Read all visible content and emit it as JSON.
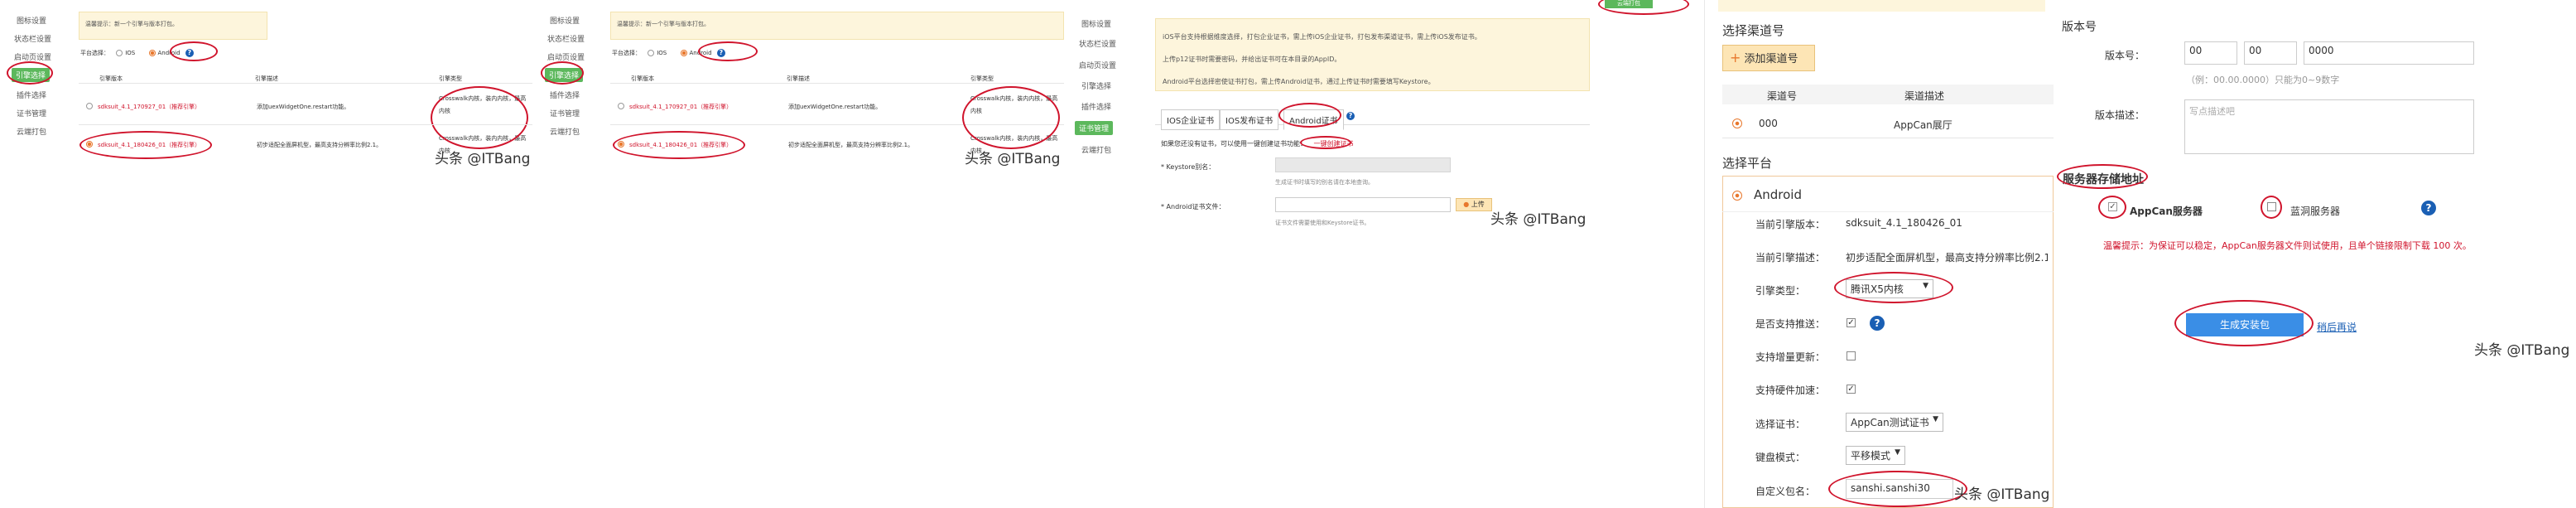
{
  "watermark": "头条 @ITBang",
  "panel1": {
    "sidebar": [
      "图标设置",
      "状态栏设置",
      "启动页设置",
      "引擎选择",
      "插件选择",
      "证书管理",
      "云端打包"
    ],
    "active_index": 3,
    "notice": "温馨提示：新一个引擎与版本打包。",
    "platform_label": "平台选择：",
    "platform_options": [
      "IOS",
      "Android"
    ],
    "table_headers": [
      "引擎版本",
      "引擎描述",
      "引擎类型"
    ],
    "rows": [
      {
        "version": "sdksuit_4.1_170927_01（推荐引擎）",
        "desc": "添加uexWidgetOne.restart功能。",
        "type": "Crosswalk内核，装内内核，最高内核"
      },
      {
        "version": "sdksuit_4.1_180426_01（推荐引擎）",
        "desc": "初步适配全面屏机型，最高支持分辨率比例2.1。",
        "type": "Crosswalk内核，装内内核，最高内核"
      }
    ]
  },
  "panel2": {
    "sidebar": [
      "图标设置",
      "状态栏设置",
      "启动页设置",
      "引擎选择",
      "插件选择",
      "证书管理",
      "云端打包"
    ],
    "active_index": 3,
    "notice": "温馨提示：新一个引擎与版本打包。",
    "platform_label": "平台选择：",
    "platform_options": [
      "IOS",
      "Android"
    ],
    "table_headers": [
      "引擎版本",
      "引擎描述",
      "引擎类型"
    ],
    "rows": [
      {
        "version": "sdksuit_4.1_170927_01（推荐引擎）",
        "desc": "添加uexWidgetOne.restart功能。",
        "type": "Crosswalk内核，装内内核，最高内核"
      },
      {
        "version": "sdksuit_4.1_180426_01（推荐引擎）",
        "desc": "初步适配全面屏机型，最高支持分辨率比例2.1。",
        "type": "Crosswalk内核，装内内核，最高内核"
      }
    ]
  },
  "panel3": {
    "sidebar": [
      "图标设置",
      "状态栏设置",
      "启动页设置",
      "引擎选择",
      "插件选择",
      "证书管理",
      "云端打包"
    ],
    "active_index": 5,
    "top_button": "云端打包",
    "notice_lines": [
      "iOS平台支持根据维度选择，打包企业证书，需上传iOS企业证书，打包发布渠道证书，需上传iOS发布证书。",
      "上传p12证书时需要密码，并给出证书可在本目录的AppID。",
      "Android平台选择密使证书打包，需上传Android证书，通过上传证书时需要填写Keystore。"
    ],
    "tabs": [
      "IOS企业证书",
      "IOS发布证书",
      "Android证书"
    ],
    "tip": "如果您还没有证书，可以使用一键创建证书功能：",
    "tip_link": "一键创建证书",
    "keystore_label": "* Keystore别名：",
    "keystore_hint": "生成证书时填写的别名请在本地查询。",
    "cert_file_label": "* Android证书文件：",
    "upload_button": "上传",
    "cert_file_hint": "证书文件需要使用和Keystore证书。"
  },
  "panel4": {
    "channel_title": "选择渠道号",
    "add_channel_button": "添加渠道号",
    "channel_headers": [
      "渠道号",
      "渠道描述"
    ],
    "channel_row": {
      "id": "000",
      "desc": "AppCan展厅"
    },
    "platform_title": "选择平台",
    "platform_name": "Android",
    "fields": {
      "engine_version_label": "当前引擎版本：",
      "engine_version": "sdksuit_4.1_180426_01",
      "engine_desc_label": "当前引擎描述：",
      "engine_desc": "初步适配全面屏机型，最高支持分辨率比例2.1",
      "engine_type_label": "引擎类型：",
      "engine_type": "腾讯X5内核",
      "push_label": "是否支持推送：",
      "incremental_label": "支持增量更新：",
      "hw_accel_label": "支持硬件加速：",
      "cert_label": "选择证书：",
      "cert": "AppCan测试证书",
      "keyboard_label": "键盘模式：",
      "keyboard": "平移模式",
      "package_label": "自定义包名：",
      "package": "sanshi.sanshi30"
    }
  },
  "panel5": {
    "version_title": "版本号",
    "version_label": "版本号：",
    "version_parts": [
      "00",
      "00",
      "0000"
    ],
    "version_hint": "（例：00.00.0000）只能为0~9数字",
    "desc_label": "版本描述：",
    "desc_placeholder": "写点描述吧",
    "storage_title": "服务器存储地址",
    "storage_options": [
      "AppCan服务器",
      "蓝洞服务器"
    ],
    "warning": "温馨提示：为保证可以稳定，AppCan服务器文件则试使用，且单个链接限制下载 100 次。",
    "generate_button": "生成安装包",
    "retry_link": "稍后再说"
  },
  "colors": {
    "accent": "#e8782d",
    "active": "#5cb85c",
    "annot": "#d0142c",
    "primary": "#3a8ee6"
  }
}
